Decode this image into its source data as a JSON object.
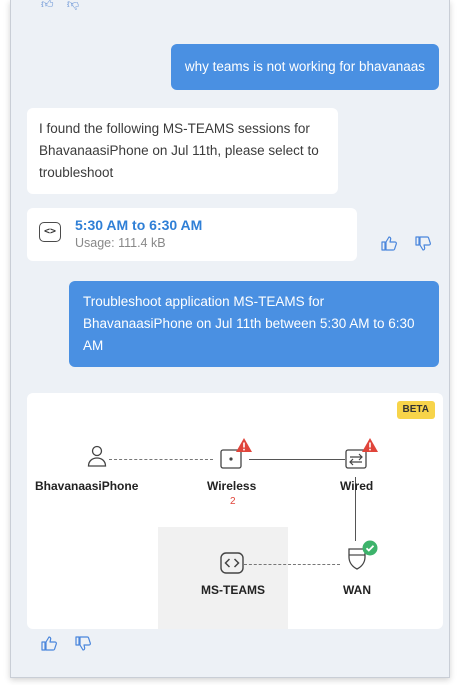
{
  "conversation": {
    "user_query": "why teams is not working for bhavanaas",
    "bot_reply": "I found the following MS-TEAMS sessions for BhavanaasiPhone on Jul 11th, please select to troubleshoot",
    "session": {
      "time_range": "5:30 AM to 6:30 AM",
      "usage": "Usage: 111.4 kB"
    },
    "user_followup": "Troubleshoot application MS-TEAMS for BhavanaasiPhone on Jul 11th between 5:30 AM to 6:30 AM"
  },
  "topology": {
    "badge": "BETA",
    "nodes": {
      "client": {
        "label": "BhavanaasiPhone",
        "icon": "user-icon"
      },
      "wireless": {
        "label": "Wireless",
        "count": "2",
        "status": "warning",
        "icon": "access-point-icon"
      },
      "wired": {
        "label": "Wired",
        "status": "warning",
        "icon": "switch-icon"
      },
      "wan": {
        "label": "WAN",
        "status": "ok",
        "icon": "router-icon"
      },
      "app": {
        "label": "MS-TEAMS",
        "icon": "code-icon"
      }
    }
  },
  "colors": {
    "accent": "#4a90e2",
    "link": "#2f7fd6",
    "warning": "#e0443a",
    "ok": "#3db36b",
    "beta": "#f7d44a",
    "panel_bg": "#edf1f6"
  }
}
